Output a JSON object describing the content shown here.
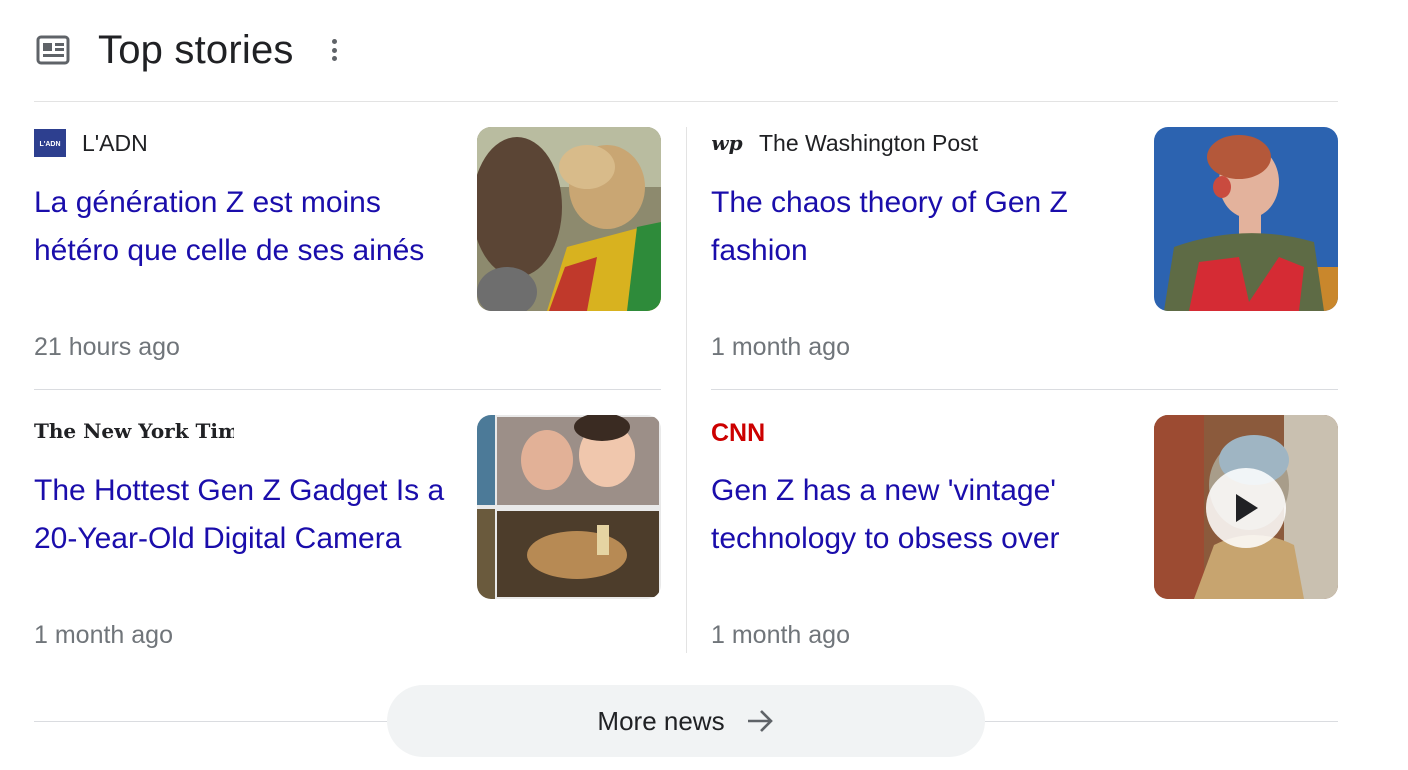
{
  "header": {
    "title": "Top stories",
    "icon": "news-icon"
  },
  "stories": [
    {
      "source": "L'ADN",
      "logo_text": "L'ADN",
      "headline": "La génération Z est moins hétéro que celle de ses ainés",
      "time": "21 hours ago"
    },
    {
      "source": "The Washington Post",
      "logo_text": "wp",
      "headline": "The chaos theory of Gen Z fashion",
      "time": "1 month ago"
    },
    {
      "source_logo": "The New York Times",
      "headline": "The Hottest Gen Z Gadget Is a 20-Year-Old Digital Camera",
      "time": "1 month ago"
    },
    {
      "source_logo": "CNN",
      "headline": "Gen Z has a new 'vintage' technology to obsess over",
      "time": "1 month ago"
    }
  ],
  "more_news": {
    "label": "More news",
    "icon": "arrow-right-icon"
  },
  "colors": {
    "headline": "#1a0dab",
    "meta": "#70757a",
    "divider": "#dadce0",
    "button_bg": "#f1f3f4"
  }
}
